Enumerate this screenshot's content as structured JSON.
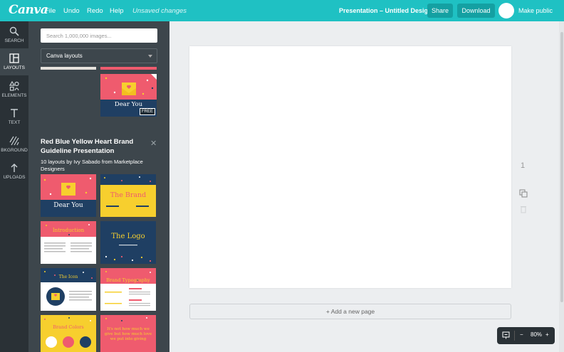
{
  "topbar": {
    "logo": "Canva",
    "menu": [
      "File",
      "Undo",
      "Redo",
      "Help"
    ],
    "status": "Unsaved changes",
    "title": "Presentation – Untitled Design",
    "share_label": "Share",
    "download_label": "Download",
    "make_public_label": "Make public"
  },
  "rail": {
    "items": [
      {
        "label": "SEARCH",
        "icon": "search-icon"
      },
      {
        "label": "LAYOUTS",
        "icon": "layouts-icon"
      },
      {
        "label": "ELEMENTS",
        "icon": "elements-icon"
      },
      {
        "label": "TEXT",
        "icon": "text-icon"
      },
      {
        "label": "BKGROUND",
        "icon": "background-icon"
      },
      {
        "label": "UPLOADS",
        "icon": "upload-icon"
      }
    ],
    "active": "LAYOUTS"
  },
  "panel": {
    "search_placeholder": "Search 1,000,000 images...",
    "layout_filter": "Canva layouts",
    "featured": {
      "text": "Dear You",
      "badge": "FREE"
    },
    "collection_title": "Red Blue Yellow Heart Brand Guideline Presentation",
    "collection_subtitle": "10 layouts by Ivy Sabado from Marketplace Designers",
    "thumbnails": [
      {
        "text": "Dear You"
      },
      {
        "text": "The Brand"
      },
      {
        "text": "Introduction"
      },
      {
        "text": "The Logo"
      },
      {
        "text": "The Icon"
      },
      {
        "text": "Brand Typography"
      },
      {
        "text": "Brand Colors"
      },
      {
        "text": "It's not how much we give but how much love we put into giving"
      }
    ]
  },
  "canvas": {
    "page_number": "1",
    "add_page_label": "+ Add a new page"
  },
  "zoom": {
    "minus": "−",
    "level": "80%",
    "plus": "+"
  },
  "colors": {
    "topbar": "#1fc1c3",
    "rail": "#2a3136",
    "panel": "#3d464c",
    "coral": "#ef5b6e",
    "navy": "#1f3f63",
    "yellow": "#f7cf2e"
  }
}
